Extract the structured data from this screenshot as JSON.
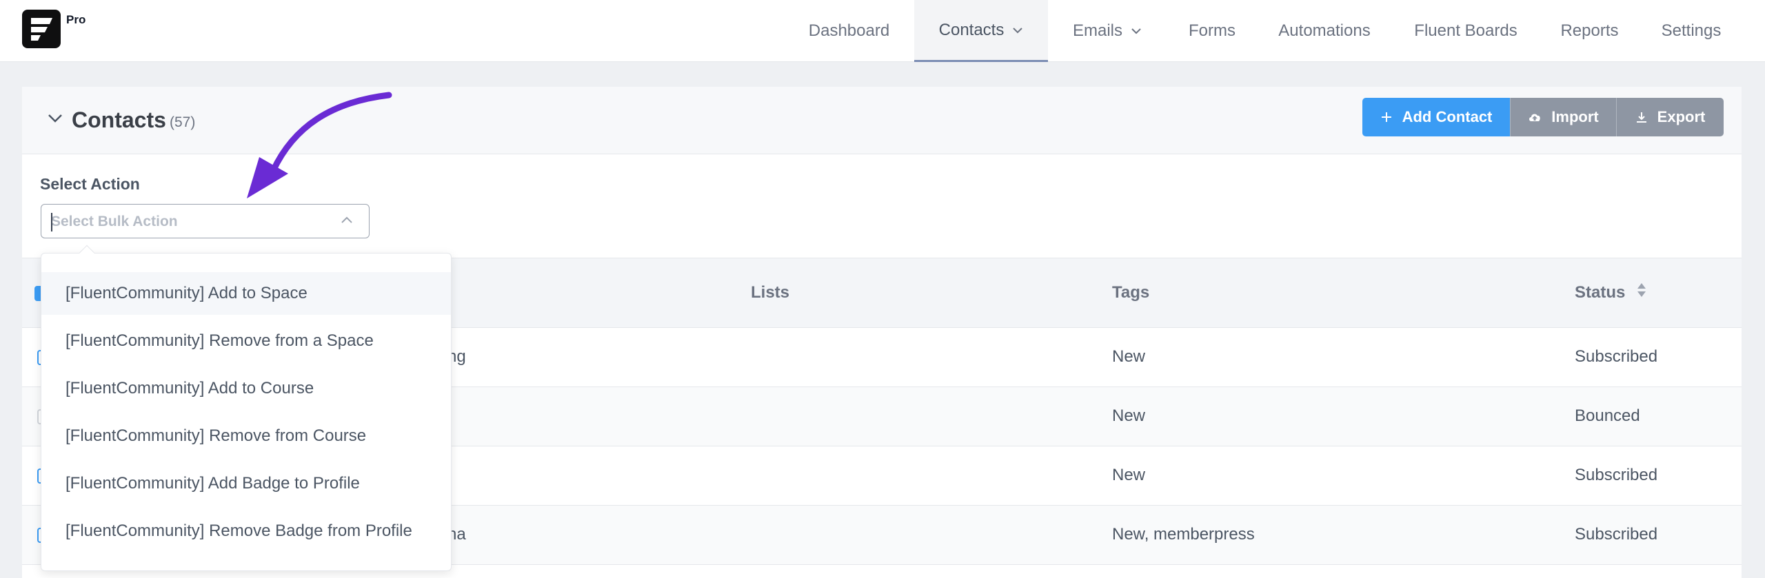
{
  "app": {
    "badge": "Pro"
  },
  "nav": {
    "items": [
      {
        "label": "Dashboard"
      },
      {
        "label": "Contacts"
      },
      {
        "label": "Emails"
      },
      {
        "label": "Forms"
      },
      {
        "label": "Automations"
      },
      {
        "label": "Fluent Boards"
      },
      {
        "label": "Reports"
      },
      {
        "label": "Settings"
      }
    ],
    "active": "Contacts"
  },
  "panel": {
    "title": "Contacts",
    "count": "(57)",
    "buttons": {
      "add": "Add Contact",
      "import": "Import",
      "export": "Export"
    }
  },
  "bulk": {
    "label": "Select Action",
    "placeholder": "Select Bulk Action",
    "options": [
      "[FluentCommunity] Add to Space",
      "[FluentCommunity] Remove from a Space",
      "[FluentCommunity] Add to Course",
      "[FluentCommunity] Remove from Course",
      "[FluentCommunity] Add Badge to Profile",
      "[FluentCommunity] Remove Badge from Profile"
    ]
  },
  "table": {
    "headers": {
      "lists": "Lists",
      "tags": "Tags",
      "status": "Status"
    },
    "rows": [
      {
        "name_fragment": "ng",
        "tags": "New",
        "status": "Subscribed"
      },
      {
        "name_fragment": "",
        "tags": "New",
        "status": "Bounced"
      },
      {
        "name_fragment": "",
        "tags": "New",
        "status": "Subscribed"
      },
      {
        "name_fragment": "na",
        "tags": "New, memberpress",
        "status": "Subscribed"
      }
    ]
  },
  "colors": {
    "primary": "#3b9cf4",
    "secondary_button": "#8e96a3",
    "annotation_arrow": "#6a2bd4"
  },
  "icons": {
    "logo": "fluentcrm-logo-icon",
    "collapse": "chevron-down-icon",
    "add": "plus-icon",
    "import": "cloud-upload-icon",
    "export": "download-icon",
    "select": "chevron-up-icon",
    "sort": "sort-icon"
  }
}
